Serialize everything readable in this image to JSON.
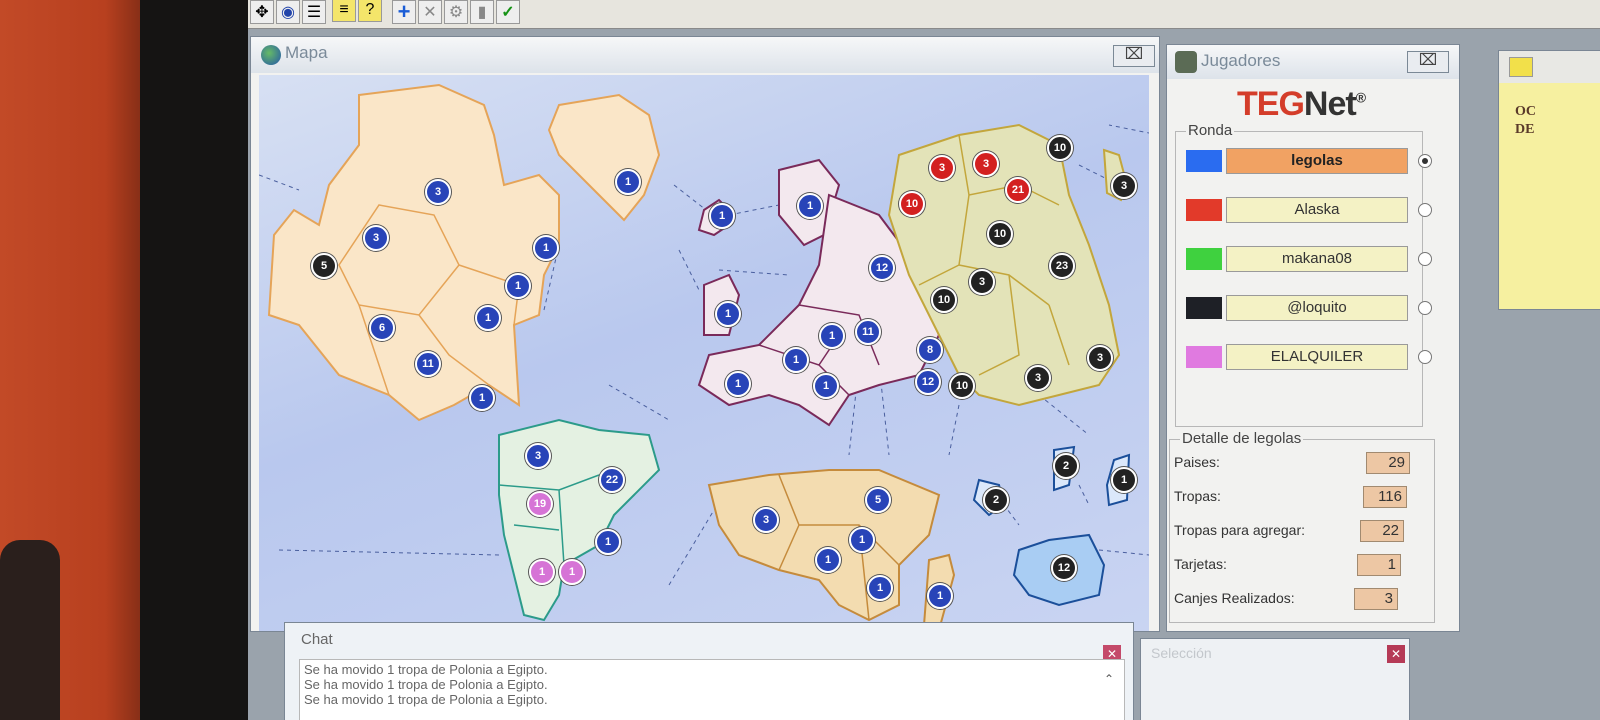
{
  "toolbar": {
    "icons": [
      "joystick-icon",
      "globe-icon",
      "list-icon",
      "note-icon",
      "help-note-icon",
      "add-icon",
      "cancel-icon",
      "gear-icon",
      "card-icon",
      "check-icon"
    ]
  },
  "mapa": {
    "title": "Mapa",
    "close": "⌧"
  },
  "map": {
    "troops": [
      {
        "n": "3",
        "color": "blue"
      },
      {
        "n": "1",
        "color": "blue"
      },
      {
        "n": "3",
        "color": "blue"
      },
      {
        "n": "5",
        "color": "black"
      },
      {
        "n": "1",
        "color": "blue"
      },
      {
        "n": "1",
        "color": "blue"
      },
      {
        "n": "6",
        "color": "blue"
      },
      {
        "n": "1",
        "color": "blue"
      },
      {
        "n": "11",
        "color": "blue"
      },
      {
        "n": "1",
        "color": "blue"
      },
      {
        "n": "1",
        "color": "blue"
      },
      {
        "n": "1",
        "color": "blue"
      },
      {
        "n": "1",
        "color": "blue"
      },
      {
        "n": "12",
        "color": "blue"
      },
      {
        "n": "1",
        "color": "blue"
      },
      {
        "n": "11",
        "color": "blue"
      },
      {
        "n": "1",
        "color": "blue"
      },
      {
        "n": "1",
        "color": "blue"
      },
      {
        "n": "1",
        "color": "blue"
      },
      {
        "n": "8",
        "color": "blue"
      },
      {
        "n": "12",
        "color": "blue"
      },
      {
        "n": "3",
        "color": "red"
      },
      {
        "n": "3",
        "color": "red"
      },
      {
        "n": "10",
        "color": "black"
      },
      {
        "n": "10",
        "color": "red"
      },
      {
        "n": "21",
        "color": "red"
      },
      {
        "n": "3",
        "color": "black"
      },
      {
        "n": "10",
        "color": "black"
      },
      {
        "n": "23",
        "color": "black"
      },
      {
        "n": "3",
        "color": "black"
      },
      {
        "n": "10",
        "color": "black"
      },
      {
        "n": "10",
        "color": "black"
      },
      {
        "n": "3",
        "color": "black"
      },
      {
        "n": "3",
        "color": "black"
      },
      {
        "n": "3",
        "color": "blue"
      },
      {
        "n": "22",
        "color": "blue"
      },
      {
        "n": "19",
        "color": "pink"
      },
      {
        "n": "1",
        "color": "blue"
      },
      {
        "n": "1",
        "color": "pink"
      },
      {
        "n": "1",
        "color": "pink"
      },
      {
        "n": "3",
        "color": "blue"
      },
      {
        "n": "5",
        "color": "blue"
      },
      {
        "n": "1",
        "color": "blue"
      },
      {
        "n": "1",
        "color": "blue"
      },
      {
        "n": "1",
        "color": "blue"
      },
      {
        "n": "1",
        "color": "blue"
      },
      {
        "n": "2",
        "color": "black"
      },
      {
        "n": "2",
        "color": "black"
      },
      {
        "n": "1",
        "color": "black"
      },
      {
        "n": "12",
        "color": "black"
      }
    ]
  },
  "jugadores": {
    "title": "Jugadores",
    "close": "⌧",
    "logo_a": "TEG",
    "logo_b": "Net",
    "logo_reg": "®",
    "ronda_label": "Ronda",
    "players": [
      {
        "name": "legolas",
        "color": "#2a6cf0",
        "active": true
      },
      {
        "name": "Alaska",
        "color": "#e23a2a",
        "active": false
      },
      {
        "name": "makana08",
        "color": "#3fd13f",
        "active": false
      },
      {
        "name": "@loquito",
        "color": "#1e2026",
        "active": false
      },
      {
        "name": "ELALQUILER",
        "color": "#e07ae0",
        "active": false
      }
    ],
    "detalle_label": "Detalle de legolas",
    "detalle": [
      {
        "label": "Paises:",
        "value": "29"
      },
      {
        "label": "Tropas:",
        "value": "116"
      },
      {
        "label": "Tropas para agregar:",
        "value": "22"
      },
      {
        "label": "Tarjetas:",
        "value": "1"
      },
      {
        "label": "Canjes Realizados:",
        "value": "3"
      }
    ]
  },
  "chat": {
    "title": "Chat",
    "lines": [
      "Se ha movido 1 tropa de Polonia a Egipto.",
      "Se ha movido 1 tropa de Polonia a Egipto.",
      "Se ha movido 1 tropa de Polonia a Egipto."
    ]
  },
  "seleccion": {
    "title": "Selección"
  },
  "objetivo": {
    "text_a": "OC",
    "text_b": "DE"
  },
  "colors": {
    "blue": "#2844b8",
    "red": "#d32020",
    "black": "#222222",
    "pink": "#d674d6"
  }
}
